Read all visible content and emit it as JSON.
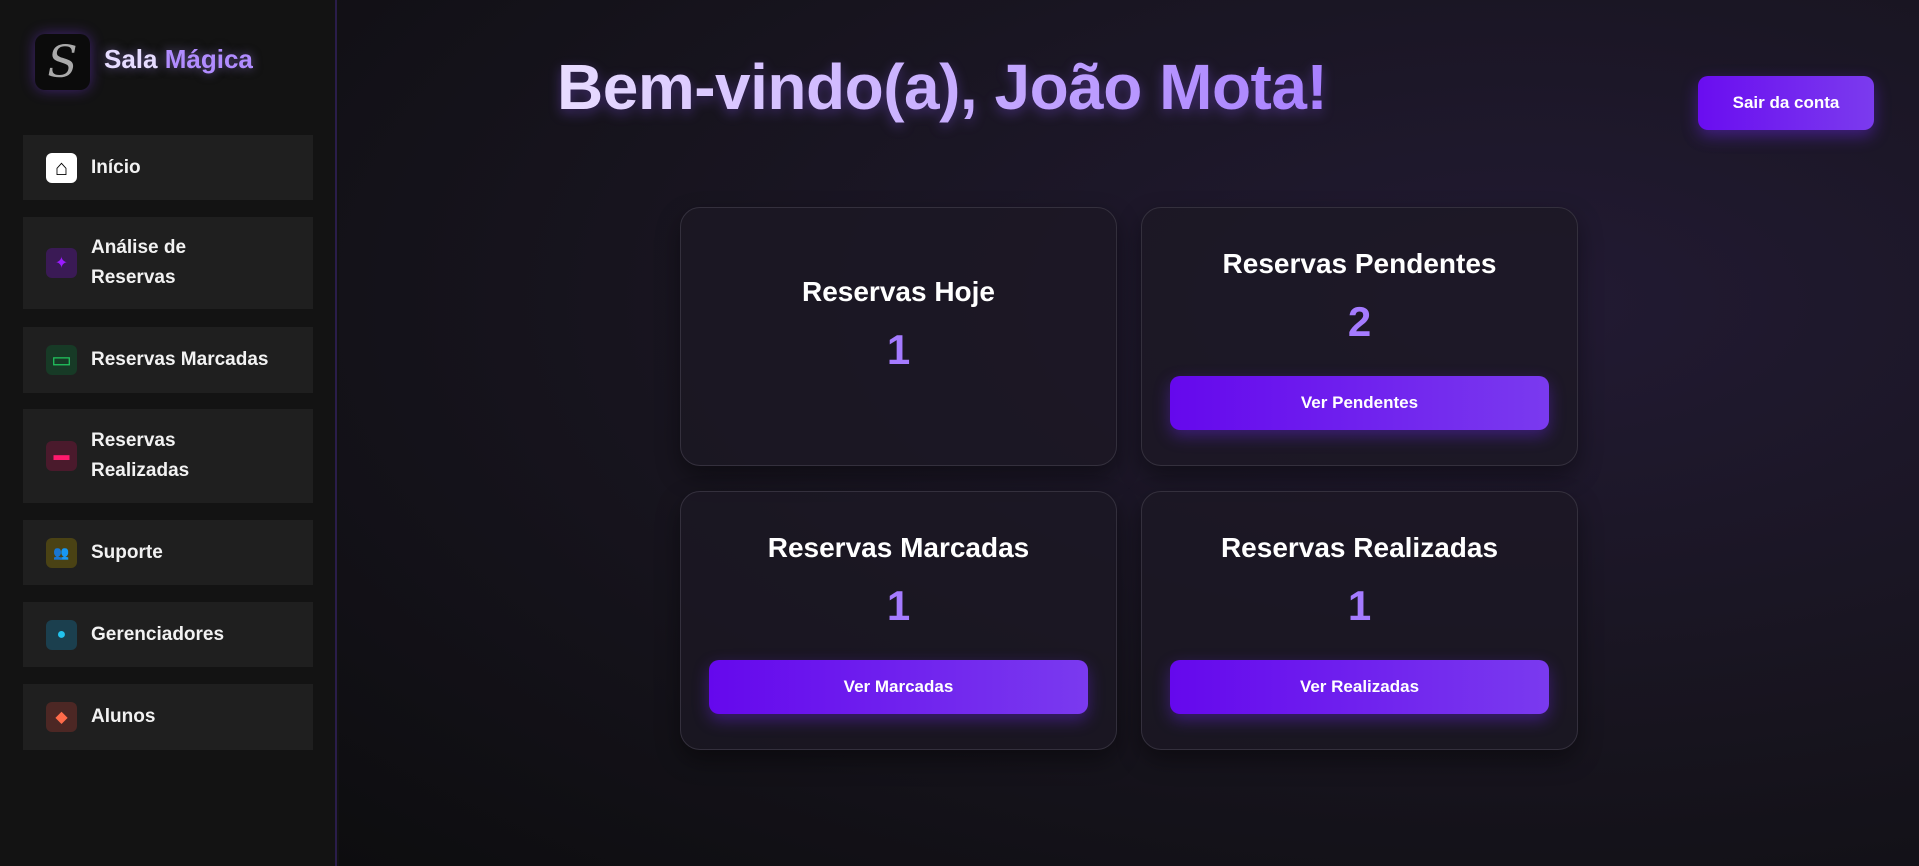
{
  "brand": {
    "part1": "Sala ",
    "part2": "Mágica",
    "logo_letter": "S"
  },
  "sidebar": {
    "items": [
      {
        "label": "Início",
        "icon": "home-icon",
        "glyph": "⌂",
        "color": "#000000",
        "bg": "#ffffff"
      },
      {
        "label": "Análise de Reservas",
        "icon": "sparkles-icon",
        "glyph": "✦",
        "color": "#9b1bff",
        "bg": "#3a1a55"
      },
      {
        "label": "Reservas Marcadas",
        "icon": "calendar-icon",
        "glyph": "▭",
        "color": "#22c55e",
        "bg": "#173a26"
      },
      {
        "label": "Reservas Realizadas",
        "icon": "presentation-icon",
        "glyph": "▬",
        "color": "#ff1a6e",
        "bg": "#4a1a2c"
      },
      {
        "label": "Suporte",
        "icon": "users-icon",
        "glyph": "👥",
        "color": "#facc15",
        "bg": "#4a4214"
      },
      {
        "label": "Gerenciadores",
        "icon": "user-icon",
        "glyph": "●",
        "color": "#22c3ee",
        "bg": "#1b3f4e"
      },
      {
        "label": "Alunos",
        "icon": "tag-icon",
        "glyph": "◆",
        "color": "#ff6b4a",
        "bg": "#4c2724"
      }
    ]
  },
  "header": {
    "title": "Bem-vindo(a), João Mota!",
    "logout": "Sair da conta"
  },
  "cards": [
    {
      "title": "Reservas Hoje",
      "value": "1"
    },
    {
      "title": "Reservas Pendentes",
      "value": "2",
      "button": "Ver Pendentes"
    },
    {
      "title": "Reservas Marcadas",
      "value": "1",
      "button": "Ver Marcadas"
    },
    {
      "title": "Reservas Realizadas",
      "value": "1",
      "button": "Ver Realizadas"
    }
  ]
}
